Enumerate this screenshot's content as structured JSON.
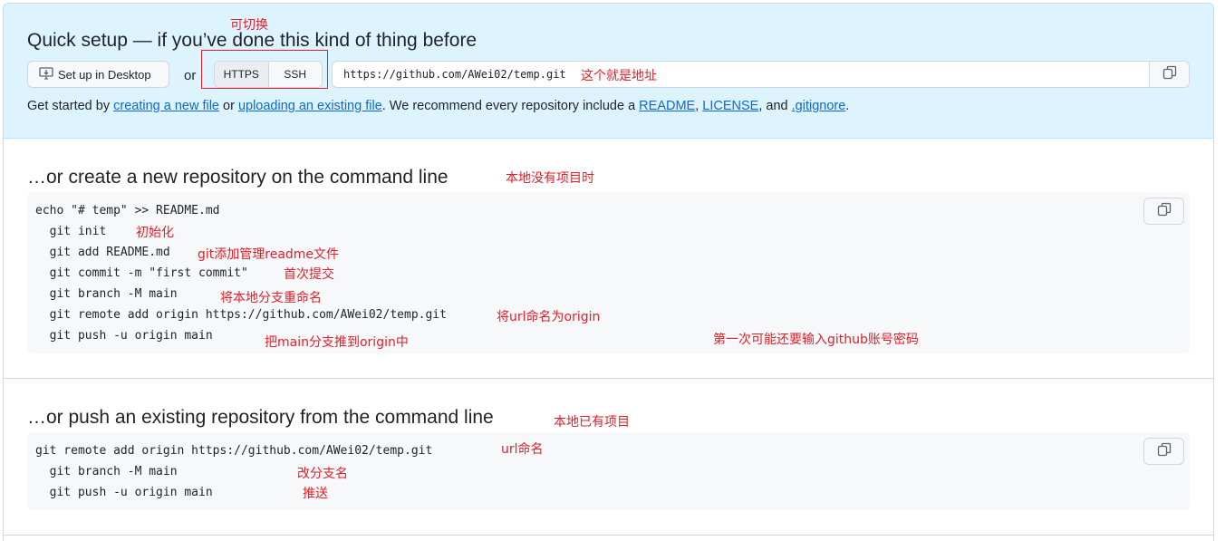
{
  "quick_setup": {
    "title": "Quick setup — if you’ve done this kind of thing before",
    "desktop_button": "Set up in Desktop",
    "or": "or",
    "protocols": [
      "HTTPS",
      "SSH"
    ],
    "url": "https://github.com/AWei02/temp.git",
    "get_started": {
      "t1": "Get started by ",
      "l1": "creating a new file",
      "t2": " or ",
      "l2": "uploading an existing file",
      "t3": ". We recommend every repository include a ",
      "l3": "README",
      "t4": ", ",
      "l4": "LICENSE",
      "t5": ", and ",
      "l5": ".gitignore",
      "t6": "."
    }
  },
  "create_section": {
    "title": "…or create a new repository on the command line",
    "lines": [
      "echo \"# temp\" >> README.md",
      "  git init",
      "  git add README.md",
      "  git commit -m \"first commit\"",
      "  git branch -M main",
      "  git remote add origin https://github.com/AWei02/temp.git",
      "  git push -u origin main"
    ]
  },
  "push_section": {
    "title": "…or push an existing repository from the command line",
    "lines": [
      "git remote add origin https://github.com/AWei02/temp.git",
      "  git branch -M main",
      "  git push -u origin main"
    ]
  },
  "annotations": {
    "switchable": "可切换",
    "this_is_address": "这个就是地址",
    "no_local_project": "本地没有项目时",
    "init": "初始化",
    "git_add_readme": "git添加管理readme文件",
    "first_commit": "首次提交",
    "rename_branch": "将本地分支重命名",
    "name_url_origin": "将url命名为origin",
    "push_main": "把main分支推到origin中",
    "first_time_login": "第一次可能还要输入github账号密码",
    "has_local_project": "本地已有项目",
    "url_naming": "url命名",
    "rename_branch2": "改分支名",
    "push": "推送"
  },
  "colors": {
    "accent_link": "#0969da",
    "quick_bg": "#ddf4ff",
    "annotation": "#e0202a",
    "code_bg": "#f6f8fa"
  },
  "icons": [
    "desktop-download-icon",
    "copy-icon"
  ]
}
